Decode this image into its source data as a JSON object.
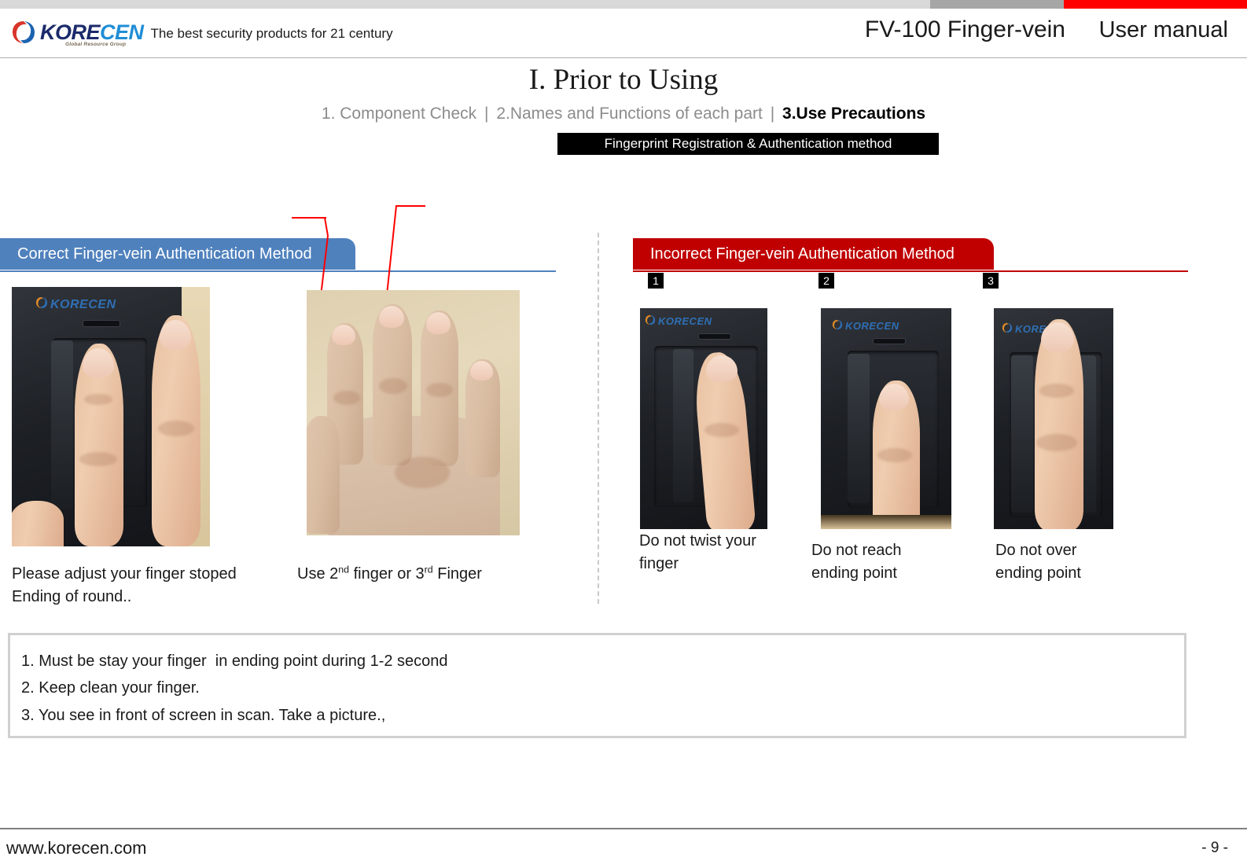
{
  "brand": {
    "logo_primary": "KORE",
    "logo_secondary": "CEN",
    "logo_subtext": "Global Resource Group",
    "tagline": "The best security products for 21 century",
    "accent_blue": "#1f8ed6",
    "accent_navy": "#1b2a6b"
  },
  "header": {
    "product_title": "FV-100 Finger-vein",
    "manual_title": "User manual",
    "bar_colors": [
      "#d9d9d9",
      "#a6a6a6",
      "#ff0000"
    ]
  },
  "page": {
    "title": "I. Prior to Using",
    "breadcrumb": [
      {
        "label": "1. Component Check",
        "active": false
      },
      {
        "label": "2.Names and Functions of each part",
        "active": false
      },
      {
        "label": "3.Use Precautions",
        "active": true
      }
    ],
    "separator": "|",
    "section_chip": "Fingerprint Registration & Authentication method"
  },
  "correct": {
    "banner": "Correct Finger-vein Authentication Method",
    "banner_color": "#4f81bd",
    "captions": [
      {
        "line1": "Please adjust your finger stoped",
        "line2": "Ending of round.."
      },
      {
        "pre": "Use 2",
        "sup1": "nd",
        "mid": " finger or 3",
        "sup2": "rd",
        "post": " Finger"
      }
    ]
  },
  "incorrect": {
    "banner": "Incorrect Finger-vein Authentication Method",
    "banner_color": "#c00000",
    "items": [
      {
        "number": "1",
        "caption_line1": "Do not twist your",
        "caption_line2": "finger"
      },
      {
        "number": "2",
        "caption_line1": "Do not reach",
        "caption_line2": "ending point"
      },
      {
        "number": "3",
        "caption_line1": "Do not over",
        "caption_line2": "ending point"
      }
    ]
  },
  "notes": [
    "1. Must be stay your finger  in ending point during 1-2 second",
    "2. Keep clean your finger.",
    "3. You see in front of screen in scan. Take a picture.,"
  ],
  "footer": {
    "website": "www.korecen.com",
    "page_number": "- 9 -"
  },
  "device_label": "KORECEN"
}
